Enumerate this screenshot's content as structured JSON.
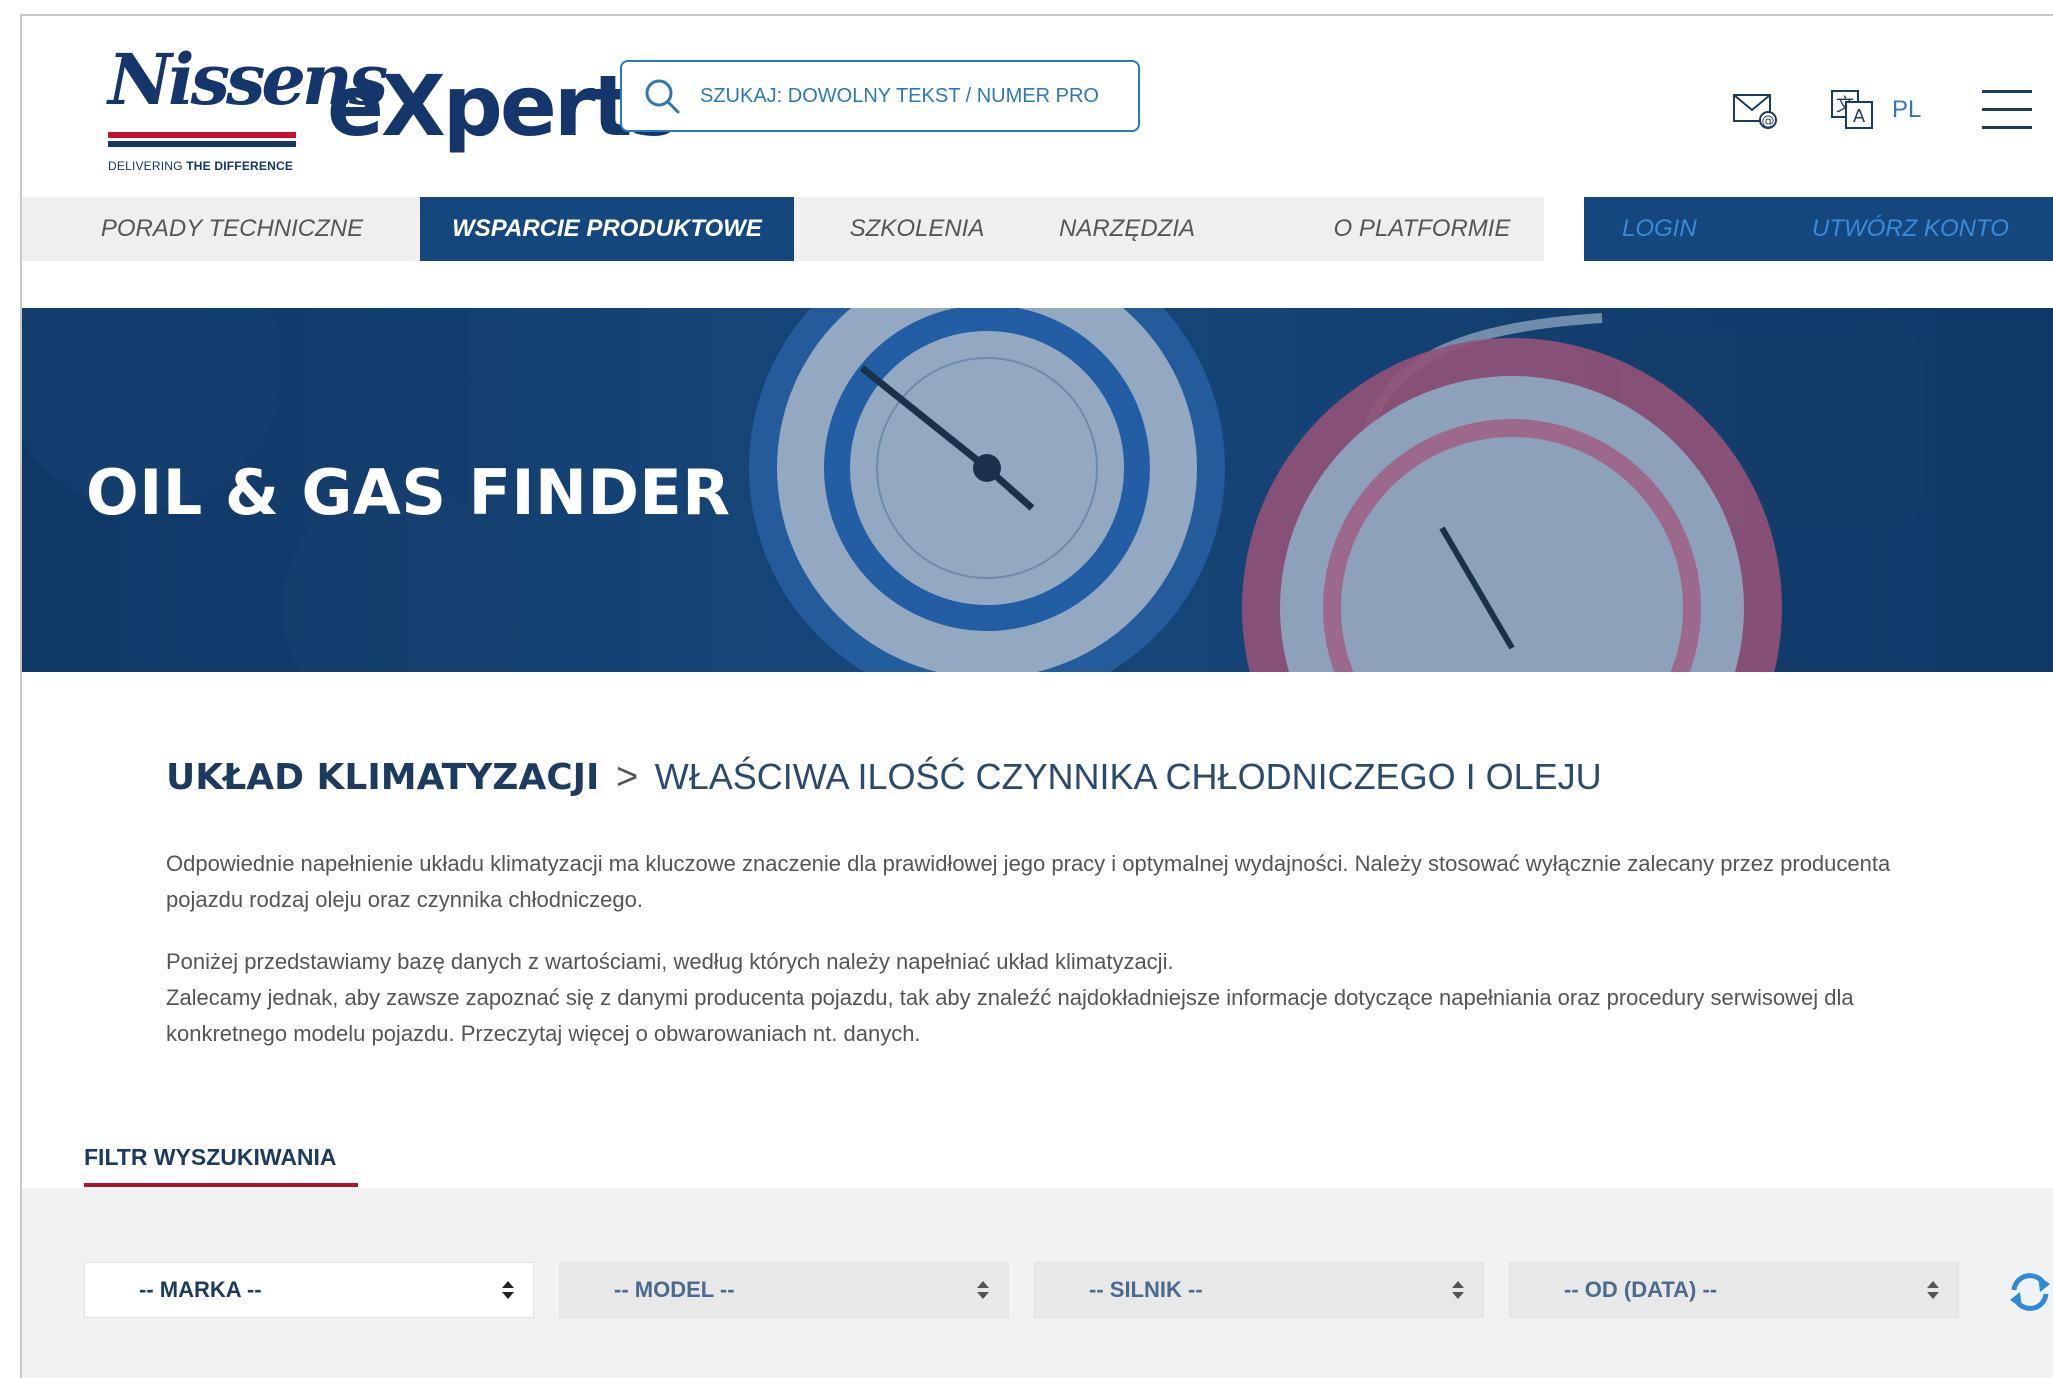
{
  "brand": {
    "logo_text": "Nissens",
    "tagline_part1": "DELIVERING",
    "tagline_part2": "THE DIFFERENCE",
    "product_name": "eXperts"
  },
  "search": {
    "placeholder": "SZUKAJ: DOWOLNY TEKST / NUMER PRODUKTU"
  },
  "header": {
    "mail_icon": "mail-at-icon",
    "translate_icon": "translate-icon",
    "language": "PL",
    "menu_icon": "hamburger-menu-icon"
  },
  "nav": {
    "items": [
      {
        "label": "PORADY TECHNICZNE",
        "active": false
      },
      {
        "label": "WSPARCIE PRODUKTOWE",
        "active": true
      },
      {
        "label": "SZKOLENIA",
        "active": false
      },
      {
        "label": "NARZĘDZIA",
        "active": false
      },
      {
        "label": "O PLATFORMIE",
        "active": false
      }
    ],
    "login": "LOGIN",
    "create_account": "UTWÓRZ KONTO"
  },
  "hero": {
    "title": "OIL & GAS FINDER"
  },
  "content": {
    "heading_bold": "UKŁAD KLIMATYZACJI",
    "heading_separator": ">",
    "heading_light": "WŁAŚCIWA ILOŚĆ CZYNNIKA CHŁODNICZEGO I OLEJU",
    "paragraph1": "Odpowiednie napełnienie układu klimatyzacji ma kluczowe znaczenie dla prawidłowej jego pracy i optymalnej wydajności. Należy stosować wyłącznie zalecany przez producenta pojazdu rodzaj oleju oraz czynnika chłodniczego.",
    "paragraph2_line1": "Poniżej przedstawiamy bazę danych z wartościami, według których należy napełniać układ klimatyzacji.",
    "paragraph2_line2": "Zalecamy jednak, aby zawsze zapoznać się z danymi producenta pojazdu, tak aby znaleźć najdokładniejsze informacje dotyczące napełniania oraz procedury serwisowej dla konkretnego modelu pojazdu. Przeczytaj więcej o obwarowaniach nt. danych."
  },
  "filter": {
    "tab_label": "FILTR WYSZUKIWANIA",
    "selects": [
      {
        "label": "-- MARKA --",
        "enabled": true
      },
      {
        "label": "-- MODEL --",
        "enabled": false
      },
      {
        "label": "-- SILNIK --",
        "enabled": false
      },
      {
        "label": "-- OD (DATA) --",
        "enabled": false
      }
    ],
    "reset_icon": "refresh-icon"
  },
  "colors": {
    "brand_blue": "#15366b",
    "nav_active": "#14477e",
    "accent_blue": "#2d78b8",
    "accent_red": "#b0122d"
  }
}
